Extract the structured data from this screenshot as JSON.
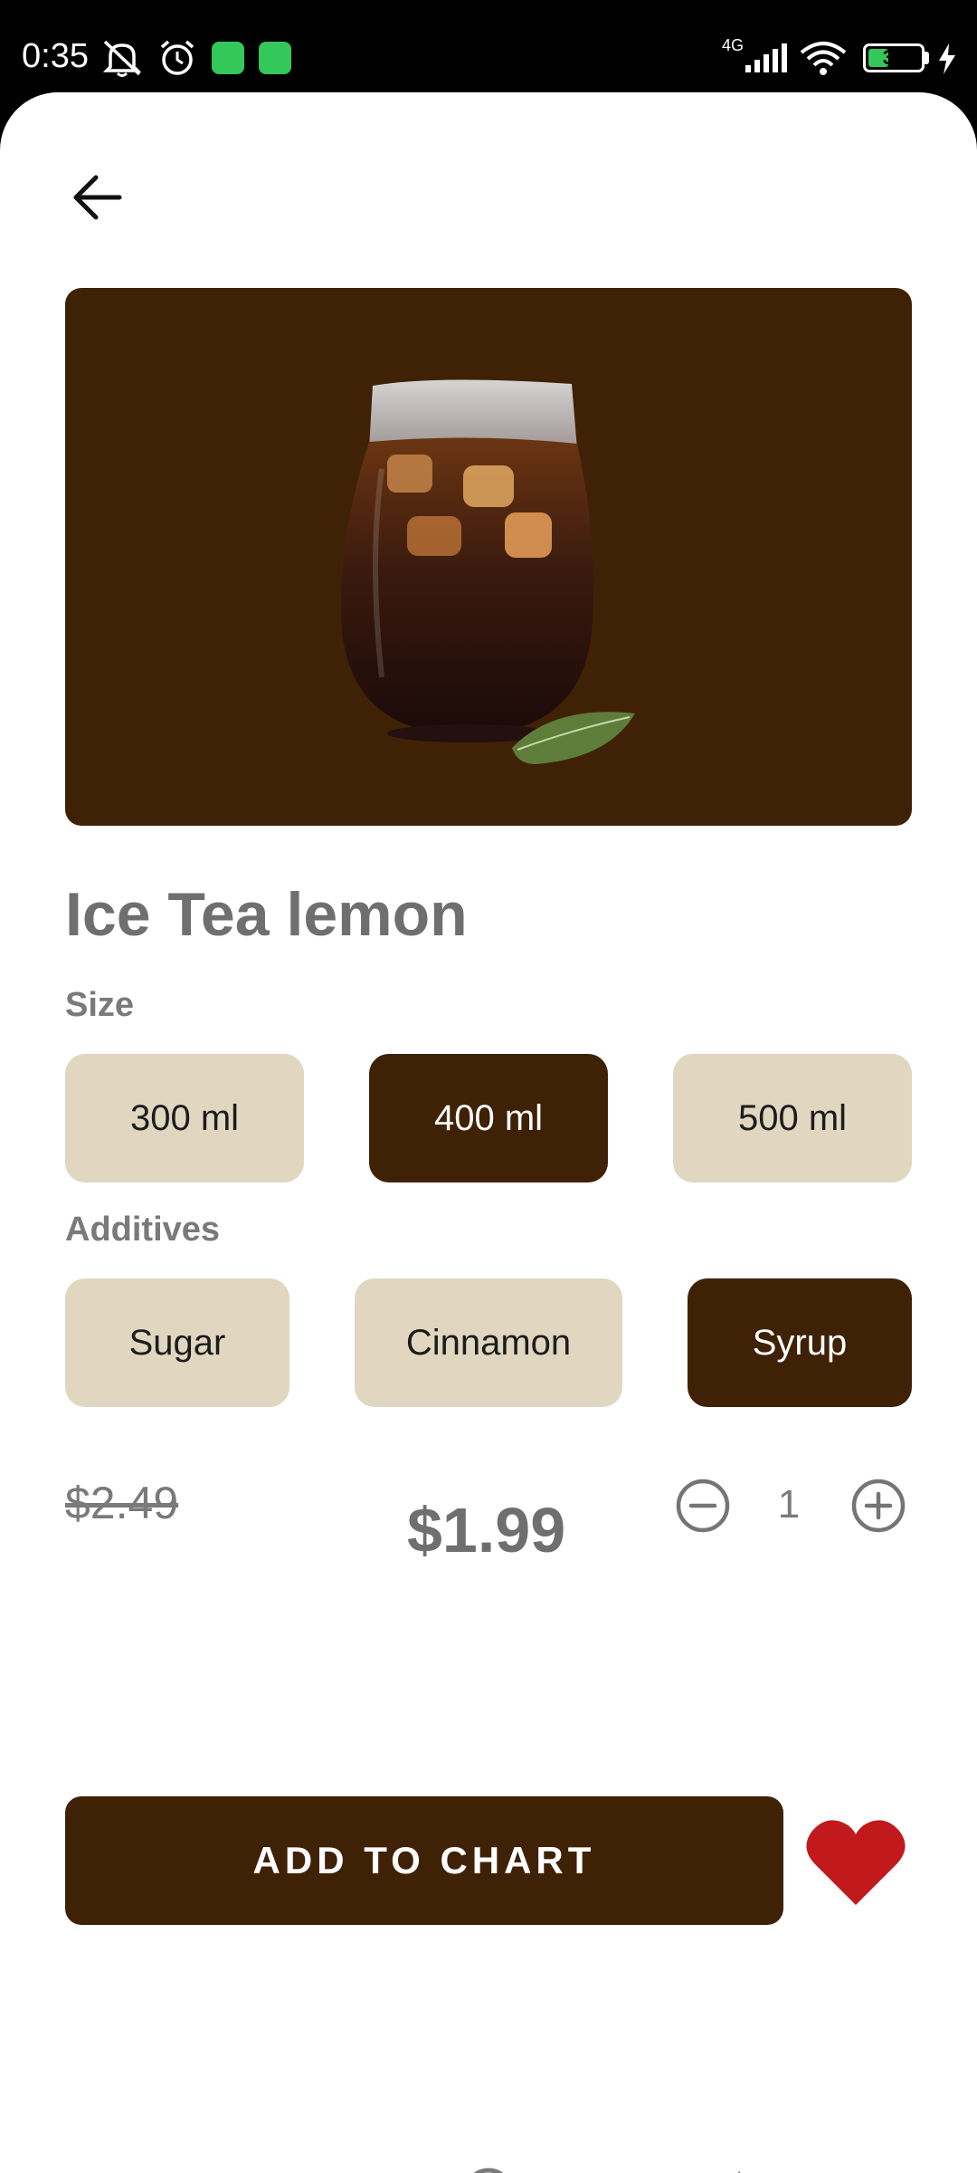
{
  "status_bar": {
    "time": "0:35",
    "network": "4G",
    "battery": "39",
    "battery_level": 0.39,
    "icons": [
      "notifications-muted-icon",
      "alarm-icon",
      "app-badge-icon",
      "app-badge-icon",
      "signal-icon",
      "wifi-icon",
      "battery-icon",
      "charging-icon"
    ]
  },
  "header": {
    "back_icon": "arrow-left-icon"
  },
  "product": {
    "image": "iced-tea-glass-with-mint",
    "title": "Ice Tea lemon"
  },
  "size": {
    "label": "Size",
    "options": [
      "300 ml",
      "400 ml",
      "500 ml"
    ],
    "selected": "400 ml"
  },
  "additives": {
    "label": "Additives",
    "options": [
      "Sugar",
      "Cinnamon",
      "Syrup"
    ],
    "selected": "Syrup"
  },
  "pricing": {
    "old_price": "$2.49",
    "price": "$1.99",
    "quantity": "1"
  },
  "actions": {
    "add_label": "ADD TO CHART",
    "favorite_icon": "heart-icon"
  },
  "nav_bar": {
    "icons": [
      "recents-square-icon",
      "home-circle-icon",
      "back-triangle-icon"
    ]
  },
  "colors": {
    "brown": "#3f2106",
    "beige": "#e1d7c0",
    "heart": "#c1191c",
    "text_gray": "#6f6f6f"
  }
}
